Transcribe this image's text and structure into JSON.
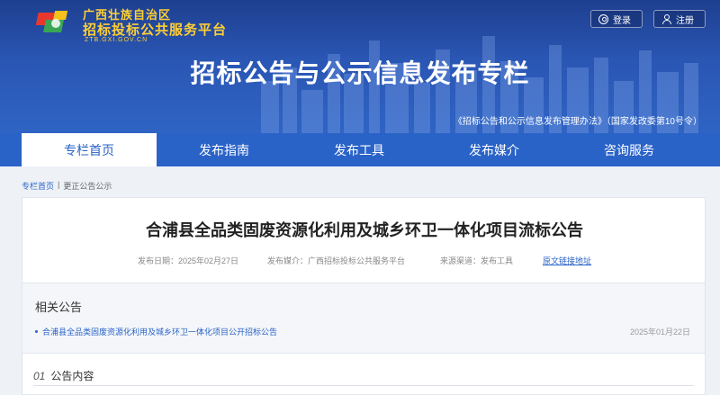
{
  "header": {
    "logo": {
      "line1": "广西壮族自治区",
      "line2": "招标投标公共服务平台",
      "domain": "ZTB.GXI.GOV.CN"
    },
    "login_label": "登录",
    "register_label": "注册",
    "banner_title": "招标公告与公示信息发布专栏",
    "banner_note": "《招标公告和公示信息发布管理办法》（国家发改委第10号令）"
  },
  "nav": {
    "items": [
      {
        "label": "专栏首页"
      },
      {
        "label": "发布指南"
      },
      {
        "label": "发布工具"
      },
      {
        "label": "发布媒介"
      },
      {
        "label": "咨询服务"
      }
    ]
  },
  "breadcrumb": {
    "home": "专栏首页",
    "separator": "|",
    "current": "更正公告公示"
  },
  "article": {
    "title": "合浦县全品类固废资源化利用及城乡环卫一体化项目流标公告",
    "date": "发布日期：2025年02月27日",
    "media": "发布媒介：广西招标投标公共服务平台",
    "channel": "来源渠道：发布工具",
    "original_link": "原文链接地址"
  },
  "related": {
    "title": "相关公告",
    "items": [
      {
        "text": "合浦县全品类固废资源化利用及城乡环卫一体化项目公开招标公告",
        "date": "2025年01月22日"
      }
    ]
  },
  "section": {
    "number": "01",
    "title": "公告内容"
  },
  "colors": {
    "primary": "#2a63c8",
    "banner_dark": "#1e3f8f",
    "logo_yellow": "#ffcf33"
  }
}
